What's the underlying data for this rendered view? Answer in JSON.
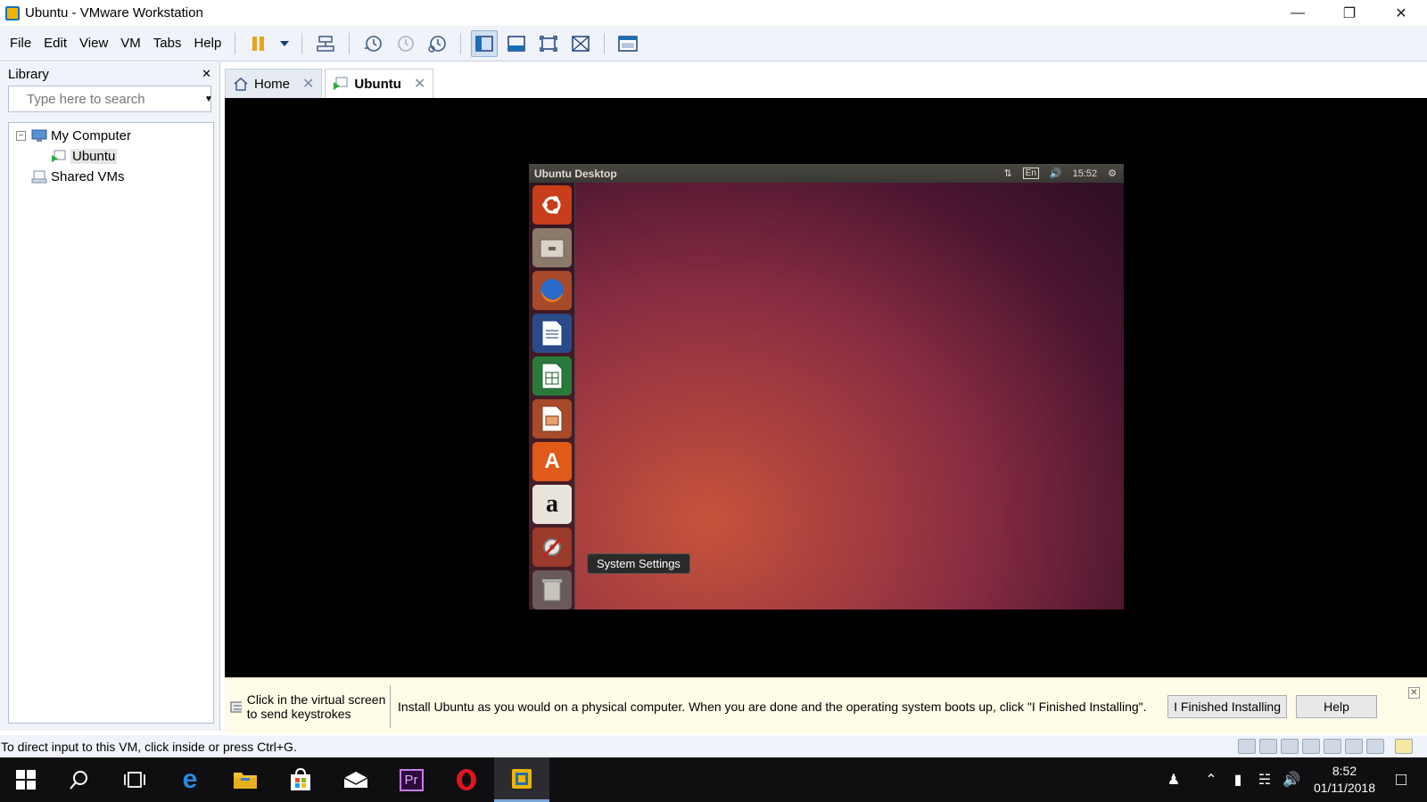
{
  "window": {
    "title": "Ubuntu - VMware Workstation",
    "minimize": "—",
    "restore": "❐",
    "close": "✕"
  },
  "menu": [
    "File",
    "Edit",
    "View",
    "VM",
    "Tabs",
    "Help"
  ],
  "library": {
    "title": "Library",
    "close": "✕",
    "search_placeholder": "Type here to search",
    "tree": {
      "expander": "−",
      "my_computer": "My Computer",
      "ubuntu": "Ubuntu",
      "shared_vms": "Shared VMs"
    }
  },
  "tabs": [
    {
      "label": "Home",
      "close": "✕"
    },
    {
      "label": "Ubuntu",
      "close": "✕"
    }
  ],
  "guest": {
    "panel_title": "Ubuntu Desktop",
    "language": "En",
    "time": "15:52",
    "tooltip": "System Settings",
    "amazon_glyph": "a",
    "software_glyph": "A"
  },
  "infobar": {
    "left_text": "Click in the virtual screen to send keystrokes",
    "message": "Install Ubuntu as you would on a physical computer. When you are done and the operating system boots up, click \"I Finished Installing\".",
    "finished_button": "I Finished Installing",
    "help_button": "Help",
    "close": "✕"
  },
  "status": {
    "text": "To direct input to this VM, click inside or press Ctrl+G."
  },
  "taskbar": {
    "clock_time": "8:52",
    "clock_date": "01/11/2018",
    "premiere_label": "Pr"
  }
}
